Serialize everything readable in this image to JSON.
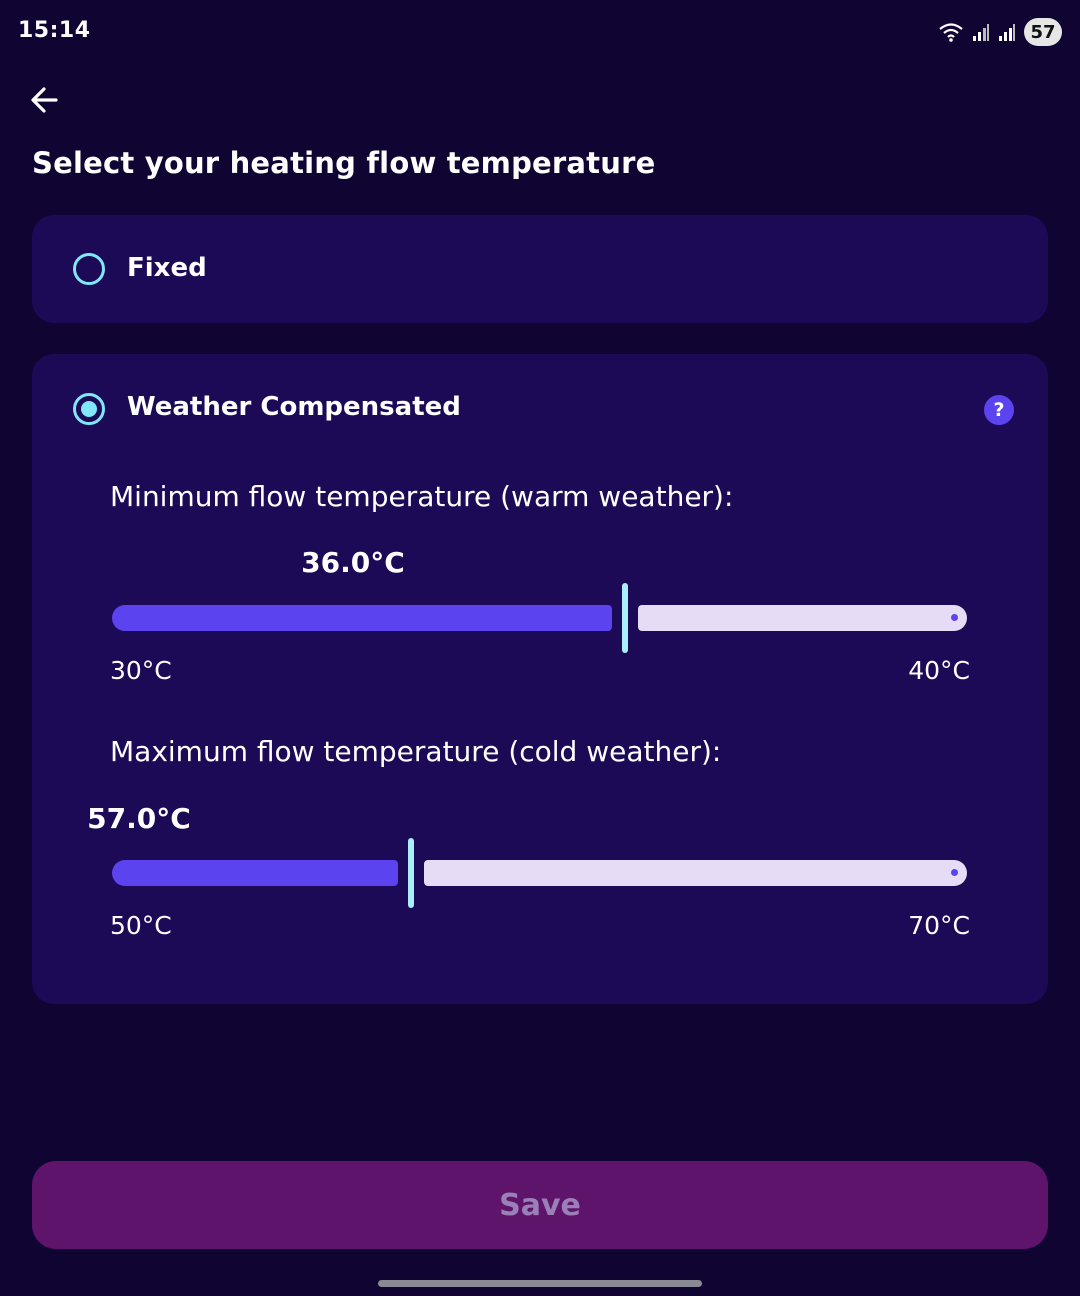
{
  "status_bar": {
    "time": "15:14",
    "battery": "57"
  },
  "header": {
    "title": "Select your heating flow temperature"
  },
  "options": {
    "fixed": {
      "label": "Fixed",
      "selected": false
    },
    "weather_compensated": {
      "label": "Weather Compensated",
      "selected": true,
      "help_label": "?"
    }
  },
  "min_slider": {
    "heading": "Minimum flow temperature (warm weather):",
    "value_label": "36.0°C",
    "value": 36.0,
    "min": 30,
    "max": 40,
    "min_label": "30°C",
    "max_label": "40°C"
  },
  "max_slider": {
    "heading": "Maximum flow temperature (cold weather):",
    "value_label": "57.0°C",
    "value": 57.0,
    "min": 50,
    "max": 70,
    "min_label": "50°C",
    "max_label": "70°C"
  },
  "footer": {
    "save_label": "Save"
  },
  "colors": {
    "background": "#100433",
    "card": "#1c0a57",
    "accent": "#5b43f0",
    "radio": "#7fe7f6",
    "track_inactive": "#e7dcf6",
    "save_button": "#5e146b"
  }
}
